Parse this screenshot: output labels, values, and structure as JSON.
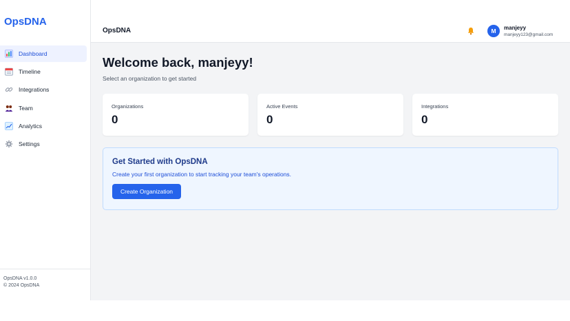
{
  "sidebar": {
    "brand": "OpsDNA",
    "items": [
      {
        "label": "Dashboard",
        "icon": "bar-chart-icon"
      },
      {
        "label": "Timeline",
        "icon": "calendar-icon"
      },
      {
        "label": "Integrations",
        "icon": "link-icon"
      },
      {
        "label": "Team",
        "icon": "people-icon"
      },
      {
        "label": "Analytics",
        "icon": "trending-chart-icon"
      },
      {
        "label": "Settings",
        "icon": "gear-icon"
      }
    ],
    "active_item": "Dashboard",
    "version": "OpsDNA v1.0.0",
    "copyright": "© 2024 OpsDNA"
  },
  "header": {
    "title": "OpsDNA",
    "notification_icon": "bell-icon",
    "user": {
      "initial": "M",
      "name": "manjeyy",
      "email": "manjeyy123@gmail.com"
    }
  },
  "main": {
    "welcome": "Welcome back, manjeyy!",
    "subtitle": "Select an organization to get started",
    "stats": [
      {
        "label": "Organizations",
        "value": "0"
      },
      {
        "label": "Active Events",
        "value": "0"
      },
      {
        "label": "Integrations",
        "value": "0"
      }
    ],
    "get_started": {
      "title": "Get Started with OpsDNA",
      "description": "Create your first organization to start tracking your team's operations.",
      "button": "Create Organization"
    }
  },
  "colors": {
    "accent": "#2563eb",
    "background": "#f3f4f6",
    "card_bg": "#ffffff",
    "callout_bg": "#eff6ff"
  }
}
